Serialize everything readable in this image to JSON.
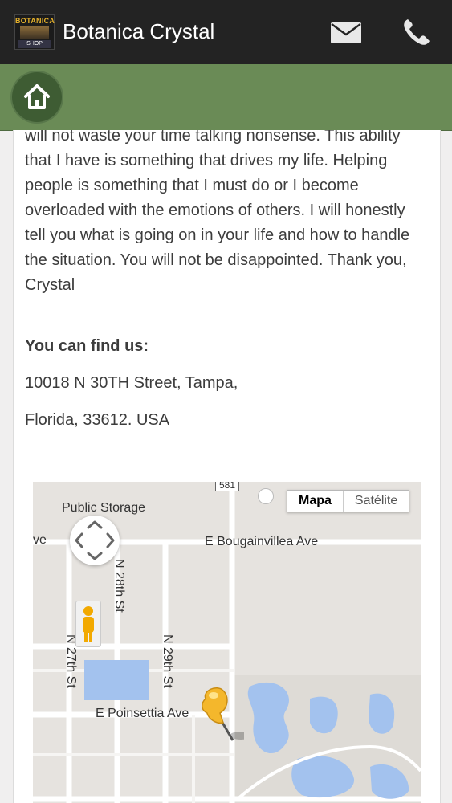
{
  "header": {
    "logo_text": "BOTANICA",
    "logo_sub": "SHOP",
    "title": "Botanica Crystal",
    "icons": [
      "mail-icon",
      "phone-icon"
    ]
  },
  "nav": {
    "home_icon": "home-icon"
  },
  "content": {
    "bio_text": "will not waste your time talking nonsense. This ability that I have is something that drives my life. Helping people is something that I must do or I become overloaded with the emotions of others. I will honestly tell you what is going on in your life and how to handle the situation. You will not be disappointed. Thank you, Crystal",
    "find_label": "You can find us:",
    "address_line1": "10018 N 30TH Street, Tampa,",
    "address_line2": "Florida, 33612. USA"
  },
  "map": {
    "type_selected": "Mapa",
    "type_other": "Satélite",
    "route_badge": "581",
    "labels": {
      "public_storage": "Public Storage",
      "e_bougainvillea": "E Bougainvillea Ave",
      "ave_fragment": "ve",
      "n_28th": "N 28th St",
      "n_27th": "N 27th St",
      "n_29th": "N 29th St",
      "e_poinsettia": "E Poinsettia Ave"
    }
  },
  "colors": {
    "topbar": "#232323",
    "navbar": "#6a8b56",
    "home_button": "#3e5c33",
    "water": "#a3c2ee"
  }
}
